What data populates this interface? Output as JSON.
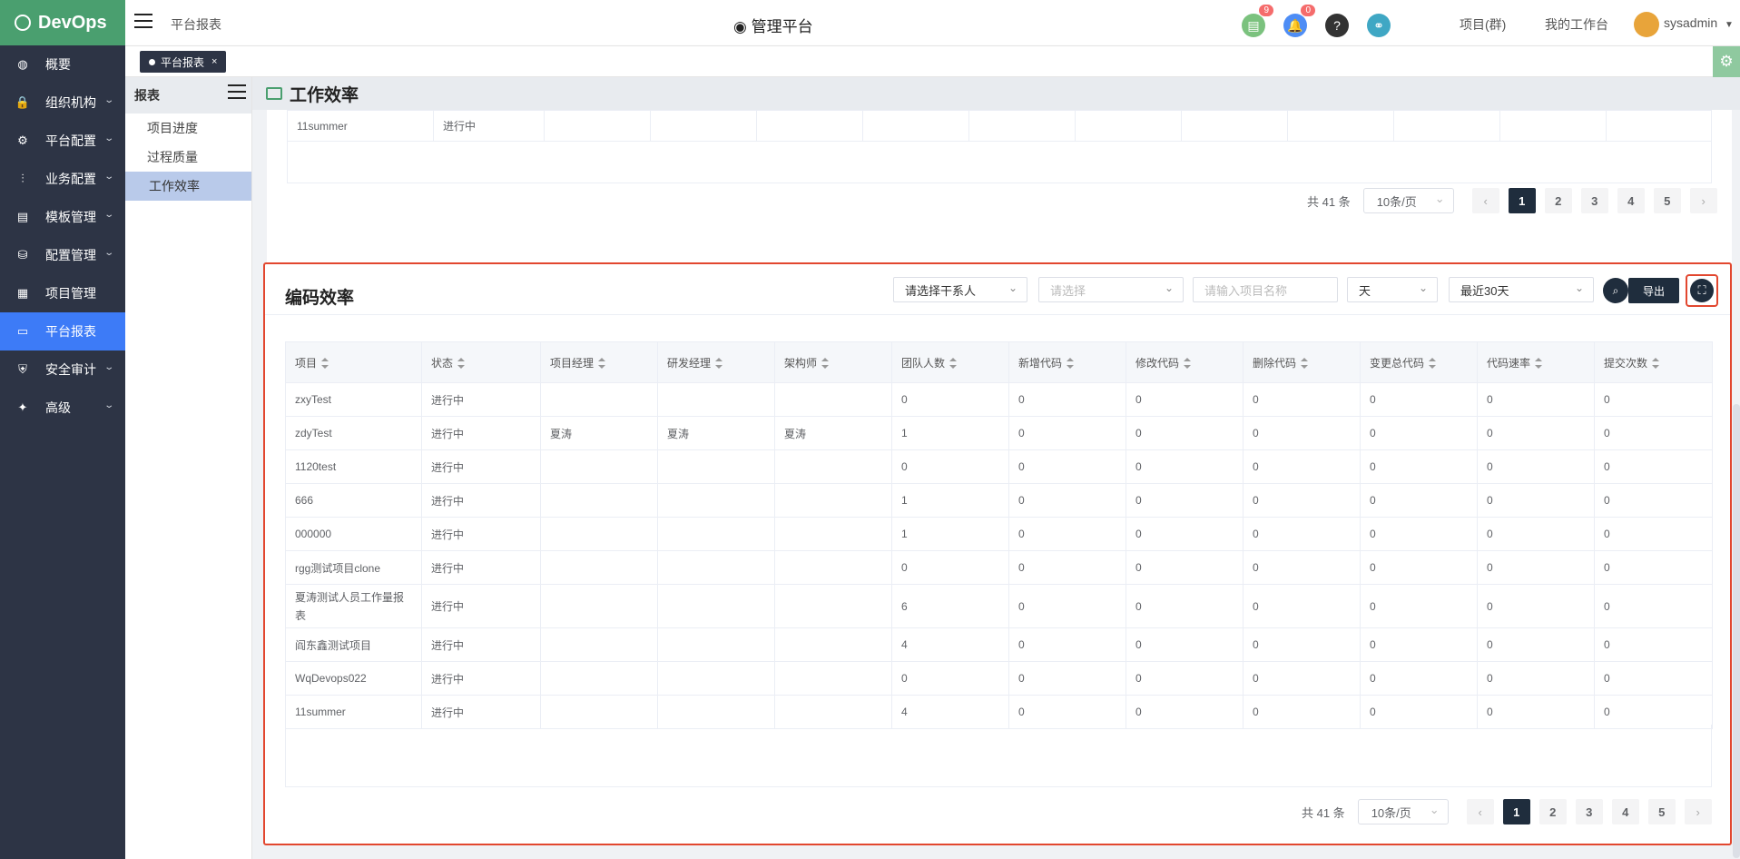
{
  "app": {
    "logo": "DevOps"
  },
  "nav": [
    {
      "label": "概要",
      "icon": "dashboard-icon",
      "glyph": "◍",
      "chev": false,
      "active": false
    },
    {
      "label": "组织机构",
      "icon": "lock-icon",
      "glyph": "🔒",
      "chev": true,
      "active": false
    },
    {
      "label": "平台配置",
      "icon": "gear-icon",
      "glyph": "⚙",
      "chev": true,
      "active": false
    },
    {
      "label": "业务配置",
      "icon": "sliders-icon",
      "glyph": "⫶",
      "chev": true,
      "active": false
    },
    {
      "label": "模板管理",
      "icon": "template-icon",
      "glyph": "▤",
      "chev": true,
      "active": false
    },
    {
      "label": "配置管理",
      "icon": "database-icon",
      "glyph": "⛁",
      "chev": true,
      "active": false
    },
    {
      "label": "项目管理",
      "icon": "grid-icon",
      "glyph": "▦",
      "chev": false,
      "active": false
    },
    {
      "label": "平台报表",
      "icon": "monitor-icon",
      "glyph": "▭",
      "chev": false,
      "active": true
    },
    {
      "label": "安全审计",
      "icon": "shield-icon",
      "glyph": "⛨",
      "chev": true,
      "active": false
    },
    {
      "label": "高级",
      "icon": "advanced-icon",
      "glyph": "✦",
      "chev": true,
      "active": false
    }
  ],
  "header": {
    "breadcrumb": "平台报表",
    "center_title": "管理平台",
    "task_badge": "9",
    "bell_badge": "0",
    "help_glyph": "?",
    "link_glyph": "⚭",
    "project_group": "项目(群)",
    "my_workspace": "我的工作台",
    "username": "sysadmin"
  },
  "tags": {
    "active_tab": "平台报表",
    "close": "×"
  },
  "submenu": {
    "title": "报表",
    "items": [
      "项目进度",
      "过程质量",
      "工作效率"
    ]
  },
  "page_title": "工作效率",
  "card1": {
    "last_row": {
      "project": "11summer",
      "status": "进行中"
    },
    "pager": {
      "total": "共 41 条",
      "size": "10条/页",
      "prev": "‹",
      "next": "›",
      "pages": [
        "1",
        "2",
        "3",
        "4",
        "5"
      ]
    }
  },
  "card2": {
    "title": "编码效率",
    "filters": {
      "contact": "请选择干系人",
      "select": "请选择",
      "project_name_placeholder": "请输入项目名称",
      "unit": "天",
      "range": "最近30天"
    },
    "export_label": "导出",
    "columns": [
      "项目",
      "状态",
      "项目经理",
      "研发经理",
      "架构师",
      "团队人数",
      "新增代码",
      "修改代码",
      "删除代码",
      "变更总代码",
      "代码速率",
      "提交次数"
    ],
    "rows": [
      [
        "zxyTest",
        "进行中",
        "",
        "",
        "",
        "0",
        "0",
        "0",
        "0",
        "0",
        "0",
        "0"
      ],
      [
        "zdyTest",
        "进行中",
        "夏涛",
        "夏涛",
        "夏涛",
        "1",
        "0",
        "0",
        "0",
        "0",
        "0",
        "0"
      ],
      [
        "1120test",
        "进行中",
        "",
        "",
        "",
        "0",
        "0",
        "0",
        "0",
        "0",
        "0",
        "0"
      ],
      [
        "666",
        "进行中",
        "",
        "",
        "",
        "1",
        "0",
        "0",
        "0",
        "0",
        "0",
        "0"
      ],
      [
        "000000",
        "进行中",
        "",
        "",
        "",
        "1",
        "0",
        "0",
        "0",
        "0",
        "0",
        "0"
      ],
      [
        "rgg测试项目clone",
        "进行中",
        "",
        "",
        "",
        "0",
        "0",
        "0",
        "0",
        "0",
        "0",
        "0"
      ],
      [
        "夏涛测试人员工作量报表",
        "进行中",
        "",
        "",
        "",
        "6",
        "0",
        "0",
        "0",
        "0",
        "0",
        "0"
      ],
      [
        "阎东鑫测试项目",
        "进行中",
        "",
        "",
        "",
        "4",
        "0",
        "0",
        "0",
        "0",
        "0",
        "0"
      ],
      [
        "WqDevops022",
        "进行中",
        "",
        "",
        "",
        "0",
        "0",
        "0",
        "0",
        "0",
        "0",
        "0"
      ],
      [
        "11summer",
        "进行中",
        "",
        "",
        "",
        "4",
        "0",
        "0",
        "0",
        "0",
        "0",
        "0"
      ]
    ],
    "pager": {
      "total": "共 41 条",
      "size": "10条/页",
      "prev": "‹",
      "next": "›",
      "pages": [
        "1",
        "2",
        "3",
        "4",
        "5"
      ]
    }
  }
}
